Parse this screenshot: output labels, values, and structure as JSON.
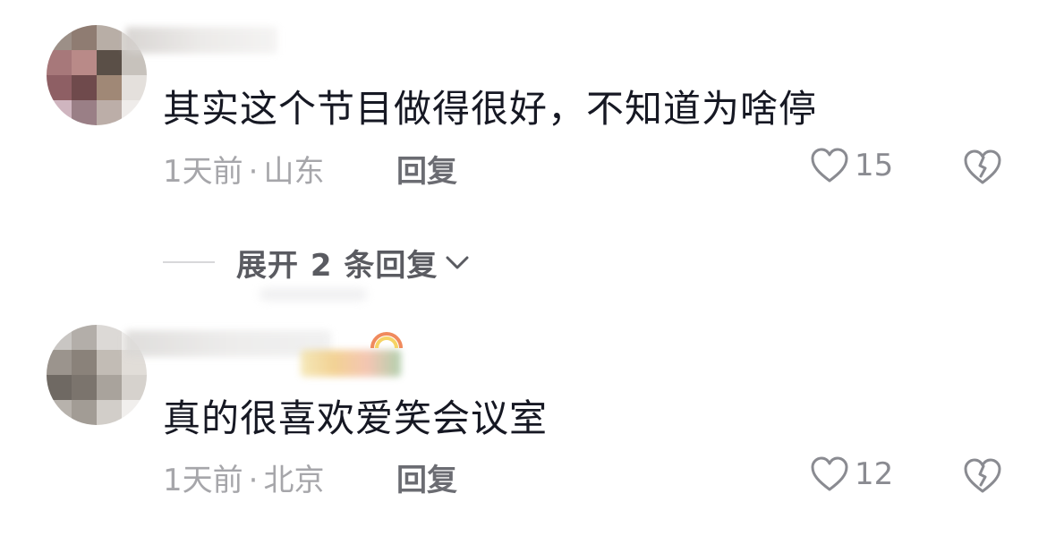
{
  "comments": [
    {
      "text": "其实这个节目做得很好，不知道为啥停",
      "time": "1天前",
      "dot": "·",
      "location": "山东",
      "reply_label": "回复",
      "like_count": "15",
      "expand_label": "展开 2 条回复"
    },
    {
      "text": "真的很喜欢爱笑会议室",
      "time": "1天前",
      "dot": "·",
      "location": "北京",
      "reply_label": "回复",
      "like_count": "12"
    }
  ],
  "icons": {
    "like": "heart-outline-icon",
    "dislike": "broken-heart-icon",
    "expand": "chevron-down-icon"
  },
  "colors": {
    "comment_text": "#161823",
    "meta_text": "#a6a6aa",
    "reply_text": "#6b6c72",
    "icon_stroke": "#8a8b91"
  }
}
